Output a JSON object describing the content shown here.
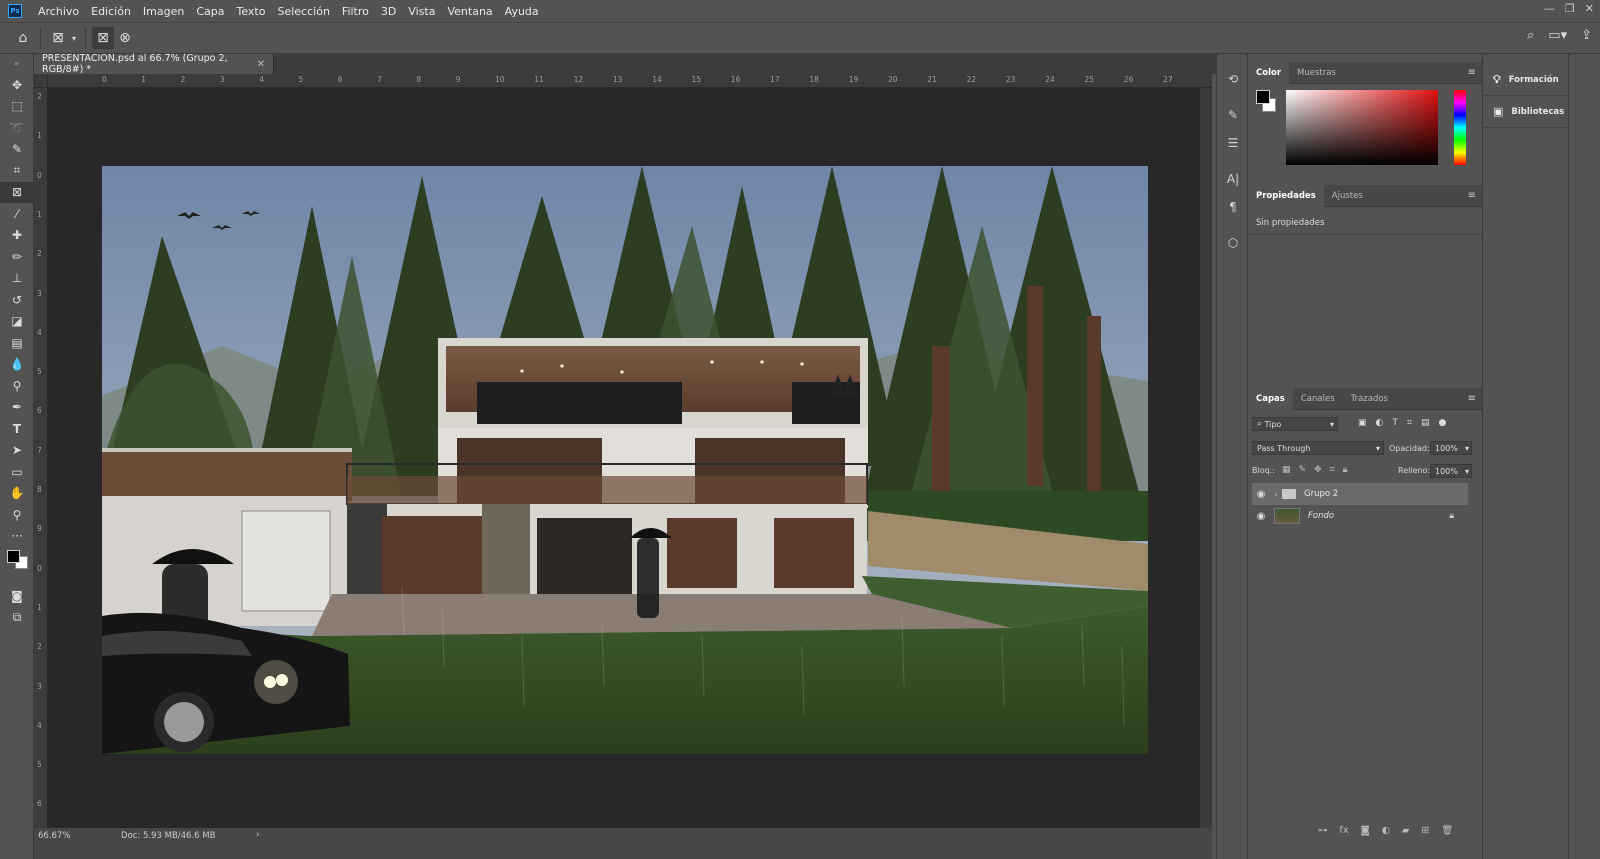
{
  "app": {
    "logo_text": "Ps"
  },
  "menu": [
    "Archivo",
    "Edición",
    "Imagen",
    "Capa",
    "Texto",
    "Selección",
    "Filtro",
    "3D",
    "Vista",
    "Ventana",
    "Ayuda"
  ],
  "document": {
    "tab_title": "PRESENTACION.psd al 66.7% (Grupo 2, RGB/8#) *",
    "zoom": "66.67%",
    "doc_info": "Doc: 5.93 MB/46.6 MB",
    "ruler_top": [
      "0",
      "1",
      "2",
      "3",
      "4",
      "5",
      "6",
      "7",
      "8",
      "9",
      "10",
      "11",
      "12",
      "13",
      "14",
      "15",
      "16",
      "17",
      "18",
      "19",
      "20",
      "21",
      "22",
      "23",
      "24",
      "25",
      "26",
      "27"
    ],
    "ruler_left": [
      "2",
      "1",
      "0",
      "1",
      "2",
      "3",
      "4",
      "5",
      "6",
      "7",
      "8",
      "9",
      "0",
      "1",
      "2",
      "3",
      "4",
      "5",
      "6"
    ]
  },
  "panels": {
    "color": {
      "tabs": [
        "Color",
        "Muestras"
      ]
    },
    "properties": {
      "tabs": [
        "Propiedades",
        "Ajustes"
      ],
      "empty_text": "Sin propiedades"
    },
    "layers": {
      "tabs": [
        "Capas",
        "Canales",
        "Trazados"
      ],
      "filter_label": "Tipo",
      "blend_mode": "Pass Through",
      "opacity_label": "Opacidad:",
      "opacity_value": "100%",
      "lock_label": "Bloq.:",
      "fill_label": "Relleno:",
      "fill_value": "100%",
      "rows": [
        {
          "name": "Grupo 2",
          "type": "group",
          "selected": true
        },
        {
          "name": "Fondo",
          "type": "image",
          "locked": true
        }
      ]
    }
  },
  "right_panels": [
    "Formación",
    "Bibliotecas"
  ],
  "colors": {
    "foreground": "#000000",
    "background": "#ffffff",
    "accent": "#31a8ff"
  },
  "icons": {
    "tools": [
      "move-icon",
      "marquee-icon",
      "lasso-icon",
      "quick-select-icon",
      "crop-icon",
      "frame-icon",
      "eyedropper-icon",
      "healing-icon",
      "brush-icon",
      "stamp-icon",
      "history-brush-icon",
      "eraser-icon",
      "gradient-icon",
      "blur-icon",
      "dodge-icon",
      "pen-icon",
      "type-icon",
      "path-select-icon",
      "shape-icon",
      "hand-icon",
      "zoom-icon",
      "more-icon"
    ]
  }
}
